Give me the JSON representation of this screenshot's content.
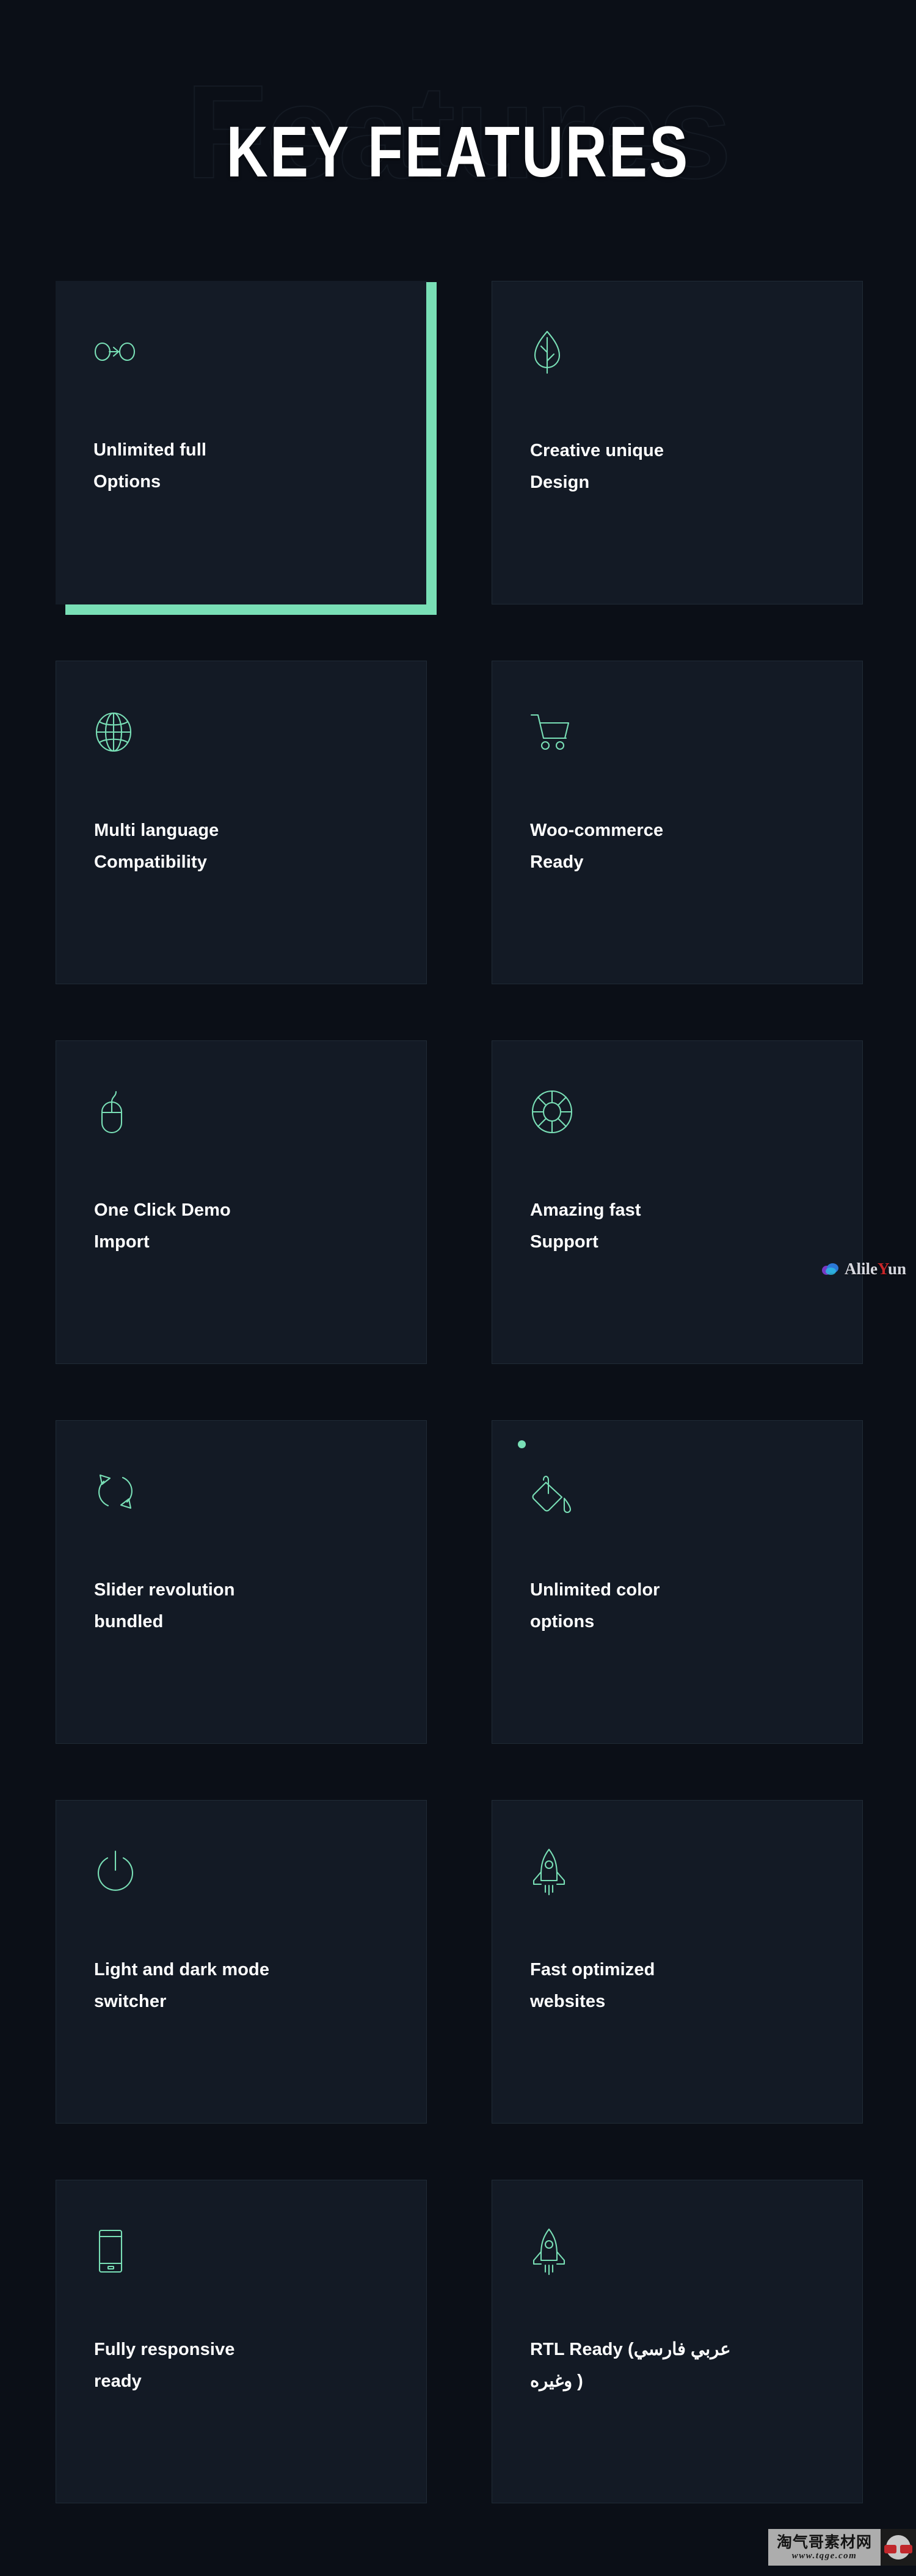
{
  "page": {
    "background_color": "#0b0f17",
    "card_background_color": "#141b26",
    "accent_color": "#79dfb6",
    "title_color": "#ffffff"
  },
  "header": {
    "title": "KEY FEATURES",
    "ghost_title": "Features"
  },
  "cards": [
    {
      "icon": "infinity-arrow-icon",
      "line1": "Unlimited full",
      "line2": "Options",
      "highlighted": true,
      "dot": false
    },
    {
      "icon": "leaf-icon",
      "line1": "Creative unique",
      "line2": "Design",
      "highlighted": false,
      "dot": false
    },
    {
      "icon": "globe-icon",
      "line1": "Multi language",
      "line2": "Compatibility",
      "highlighted": false,
      "dot": false
    },
    {
      "icon": "shopping-cart-icon",
      "line1": "Woo-commerce",
      "line2": "Ready",
      "highlighted": false,
      "dot": false
    },
    {
      "icon": "computer-mouse-icon",
      "line1": "One Click Demo",
      "line2": "Import",
      "highlighted": false,
      "dot": false
    },
    {
      "icon": "lifebuoy-icon",
      "line1": "Amazing fast",
      "line2": "Support",
      "highlighted": false,
      "dot": false
    },
    {
      "icon": "refresh-arrows-icon",
      "line1": "Slider revolution",
      "line2": "bundled",
      "highlighted": false,
      "dot": false
    },
    {
      "icon": "paint-bucket-icon",
      "line1": "Unlimited color",
      "line2": "options",
      "highlighted": false,
      "dot": true
    },
    {
      "icon": "power-button-icon",
      "line1": "Light and dark mode",
      "line2": "switcher",
      "highlighted": false,
      "dot": false
    },
    {
      "icon": "rocket-icon",
      "line1": "Fast optimized",
      "line2": "websites",
      "highlighted": false,
      "dot": false
    },
    {
      "icon": "mobile-phone-icon",
      "line1": "Fully responsive",
      "line2": "ready",
      "highlighted": false,
      "dot": false
    },
    {
      "icon": "rocket-icon",
      "line1": "RTL Ready (عربي فارسي",
      "line2": "وغيره )",
      "highlighted": false,
      "dot": false
    }
  ],
  "watermarks": {
    "alileyun": {
      "prefix": "Alile",
      "accent": "Y",
      "suffix": "un"
    },
    "tqge": {
      "cn": "淘气哥素材网",
      "url": "www.tqge.com"
    }
  }
}
